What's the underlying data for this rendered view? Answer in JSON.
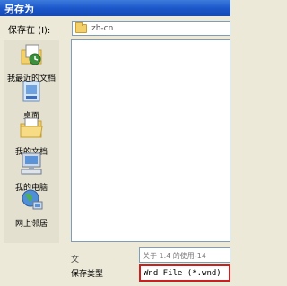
{
  "window": {
    "title": "另存为"
  },
  "save_in": {
    "label": "保存在 (I):",
    "folder": "zh-cn"
  },
  "places": [
    {
      "label": "我最近的文档",
      "icon": "recent-documents-icon"
    },
    {
      "label": "桌面",
      "icon": "desktop-icon"
    },
    {
      "label": "我的文档",
      "icon": "my-documents-icon"
    },
    {
      "label": "我的电脑",
      "icon": "my-computer-icon"
    },
    {
      "label": "网上邻居",
      "icon": "network-places-icon"
    }
  ],
  "file_name": {
    "label": "文",
    "value": "关于 1.4 的使用-14"
  },
  "save_type": {
    "label": "保存类型",
    "value": "Wnd File (*.wnd)"
  },
  "colors": {
    "titlebar": "#1a55c8",
    "highlight_border": "#cc2020"
  }
}
